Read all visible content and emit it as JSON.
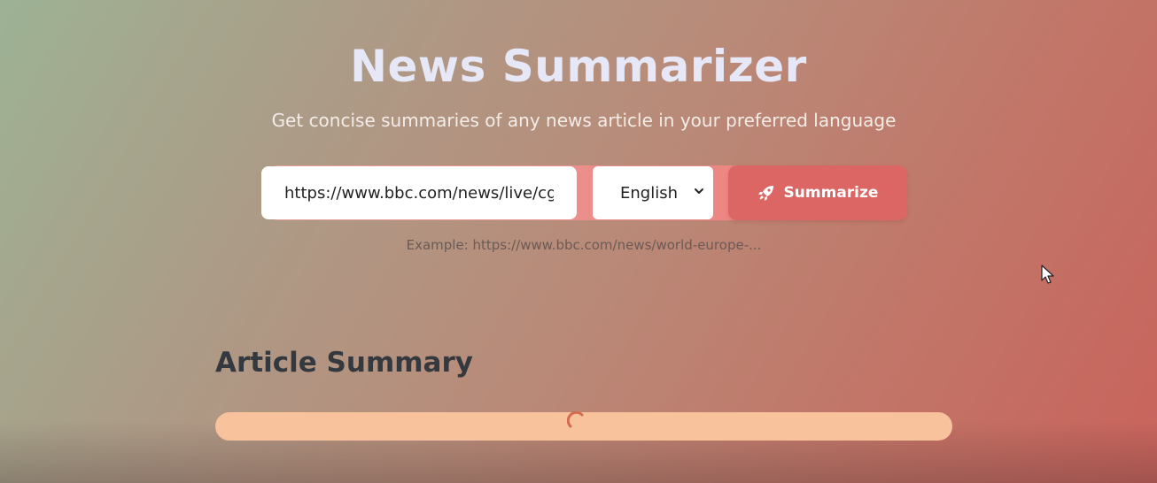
{
  "header": {
    "title": "News Summarizer",
    "subtitle": "Get concise summaries of any news article in your preferred language"
  },
  "form": {
    "url_value": "https://www.bbc.com/news/live/cg",
    "language": {
      "selected": "English",
      "icon": "chevron-down-icon"
    },
    "submit": {
      "label": "Summarize",
      "icon": "rocket-icon"
    }
  },
  "example_text": "Example: https://www.bbc.com/news/world-europe-...",
  "summary": {
    "heading": "Article Summary",
    "loading": true,
    "loading_icon": "spinner-icon"
  },
  "theme": {
    "title_color": "#e6e8f7",
    "button_color": "#dc6664",
    "summary_bar_color": "#f7c29c",
    "spinner_color": "#d46a50",
    "heading_color": "#34383f"
  }
}
